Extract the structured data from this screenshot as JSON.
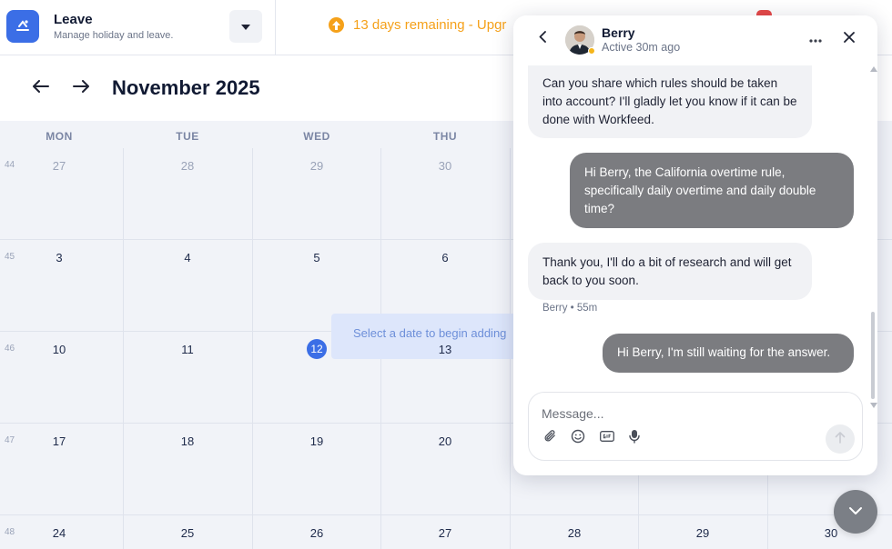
{
  "app": {
    "title": "Leave",
    "subtitle": "Manage holiday and leave."
  },
  "banner": {
    "text": "13 days remaining - Upgr"
  },
  "month": {
    "title": "November 2025"
  },
  "calendar": {
    "weekdays": [
      "MON",
      "TUE",
      "WED",
      "THU"
    ],
    "weeks": [
      {
        "number": "44",
        "days": [
          "27",
          "28",
          "29",
          "30"
        ]
      },
      {
        "number": "45",
        "days": [
          "3",
          "4",
          "5",
          "6"
        ]
      },
      {
        "number": "46",
        "days": [
          "10",
          "11",
          "12",
          "13"
        ]
      },
      {
        "number": "47",
        "days": [
          "17",
          "18",
          "19",
          "20"
        ]
      },
      {
        "number": "48",
        "days": [
          "24",
          "25",
          "26",
          "27",
          "28",
          "29",
          "30"
        ]
      }
    ],
    "today": "12",
    "select_hint": "Select a date to begin adding"
  },
  "chat": {
    "name": "Berry",
    "status": "Active 30m ago",
    "messages": [
      {
        "from": "in",
        "text": "Can you share which rules should be taken into account? I'll gladly let you know if it can be done with Workfeed."
      },
      {
        "from": "out",
        "text": "Hi Berry, the California overtime rule, specifically daily overtime and daily double time?"
      },
      {
        "from": "in",
        "text": "Thank you, I'll do a bit of research and will get back to you soon."
      },
      {
        "from": "out",
        "text": "Hi Berry, I'm still waiting for the answer."
      }
    ],
    "meta": "Berry • 55m",
    "composer_placeholder": "Message..."
  },
  "colors": {
    "accent": "#3b6ee6",
    "warning": "#f5a11a",
    "outgoing_bubble": "#7b7c80"
  }
}
